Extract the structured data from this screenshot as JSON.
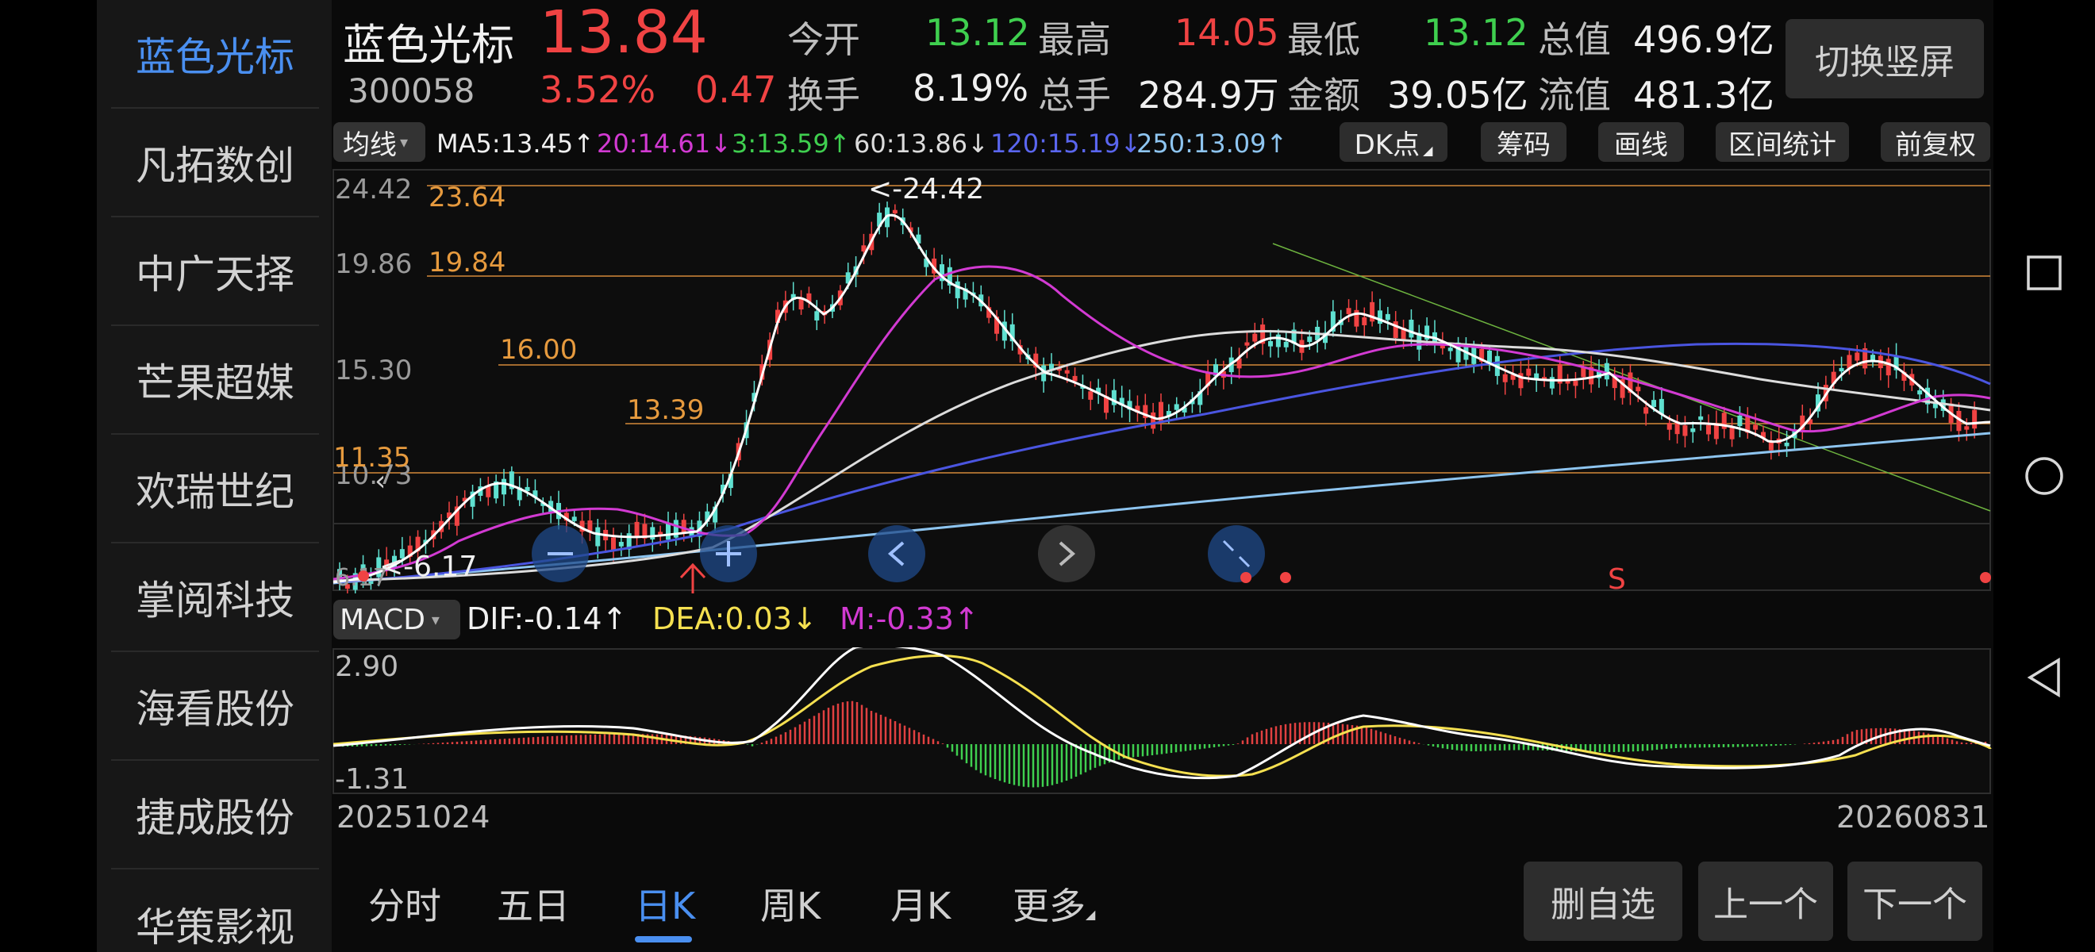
{
  "sidebar": {
    "items": [
      {
        "label": "蓝色光标"
      },
      {
        "label": "凡拓数创"
      },
      {
        "label": "中广天择"
      },
      {
        "label": "芒果超媒"
      },
      {
        "label": "欢瑞世纪"
      },
      {
        "label": "掌阅科技"
      },
      {
        "label": "海看股份"
      },
      {
        "label": "捷成股份"
      },
      {
        "label": "华策影视"
      }
    ]
  },
  "quote": {
    "name": "蓝色光标",
    "code": "300058",
    "price": "13.84",
    "change_pct": "3.52%",
    "change": "0.47",
    "open_label": "今开",
    "open": "13.12",
    "high_label": "最高",
    "high": "14.05",
    "low_label": "最低",
    "low": "13.12",
    "total_value_label": "总值",
    "total_value": "496.9亿",
    "turnover_label": "换手",
    "turnover": "8.19%",
    "volume_label": "总手",
    "volume": "284.9万",
    "amount_label": "金额",
    "amount": "39.05亿",
    "float_value_label": "流值",
    "float_value": "481.3亿",
    "switch_label": "切换竖屏"
  },
  "toolbar": {
    "ma_select": "均线",
    "ma5": "MA5:13.45↑",
    "ma20": "20:14.61↓",
    "ma3": "3:13.59↑",
    "ma60": "60:13.86↓",
    "ma120": "120:15.19↓",
    "ma250": "250:13.09↑",
    "dk_label": "DK点",
    "chip_label": "筹码",
    "draw_label": "画线",
    "range_label": "区间统计",
    "adjust_label": "前复权"
  },
  "kline": {
    "y_ticks": [
      "24.42",
      "19.86",
      "15.30",
      "10.73",
      "6.17"
    ],
    "level_lines": [
      "23.64",
      "19.84",
      "16.00",
      "13.39",
      "11.35"
    ],
    "max_label": "<-24.42",
    "min_label": "<-6.17",
    "signal_label": "S"
  },
  "macd": {
    "select": "MACD",
    "dif": "DIF:-0.14↑",
    "dea": "DEA:0.03↓",
    "m": "M:-0.33↑",
    "y_max": "2.90",
    "y_min": "-1.31"
  },
  "dates": {
    "start": "20251024",
    "end": "20260831"
  },
  "tabs": [
    {
      "label": "分时"
    },
    {
      "label": "五日"
    },
    {
      "label": "日K"
    },
    {
      "label": "周K"
    },
    {
      "label": "月K"
    },
    {
      "label": "更多"
    }
  ],
  "actions": {
    "remove_watch": "删自选",
    "prev": "上一个",
    "next": "下一个"
  },
  "colors": {
    "up": "#f04343",
    "down": "#3fcf4f",
    "accent": "#4a8ff0",
    "ma5": "#ffffff",
    "ma20": "#d23ad2",
    "ma60": "#dcdcdc",
    "ma120": "#4a55e0",
    "ma250": "#8ec5f0",
    "dea": "#f5e050"
  }
}
